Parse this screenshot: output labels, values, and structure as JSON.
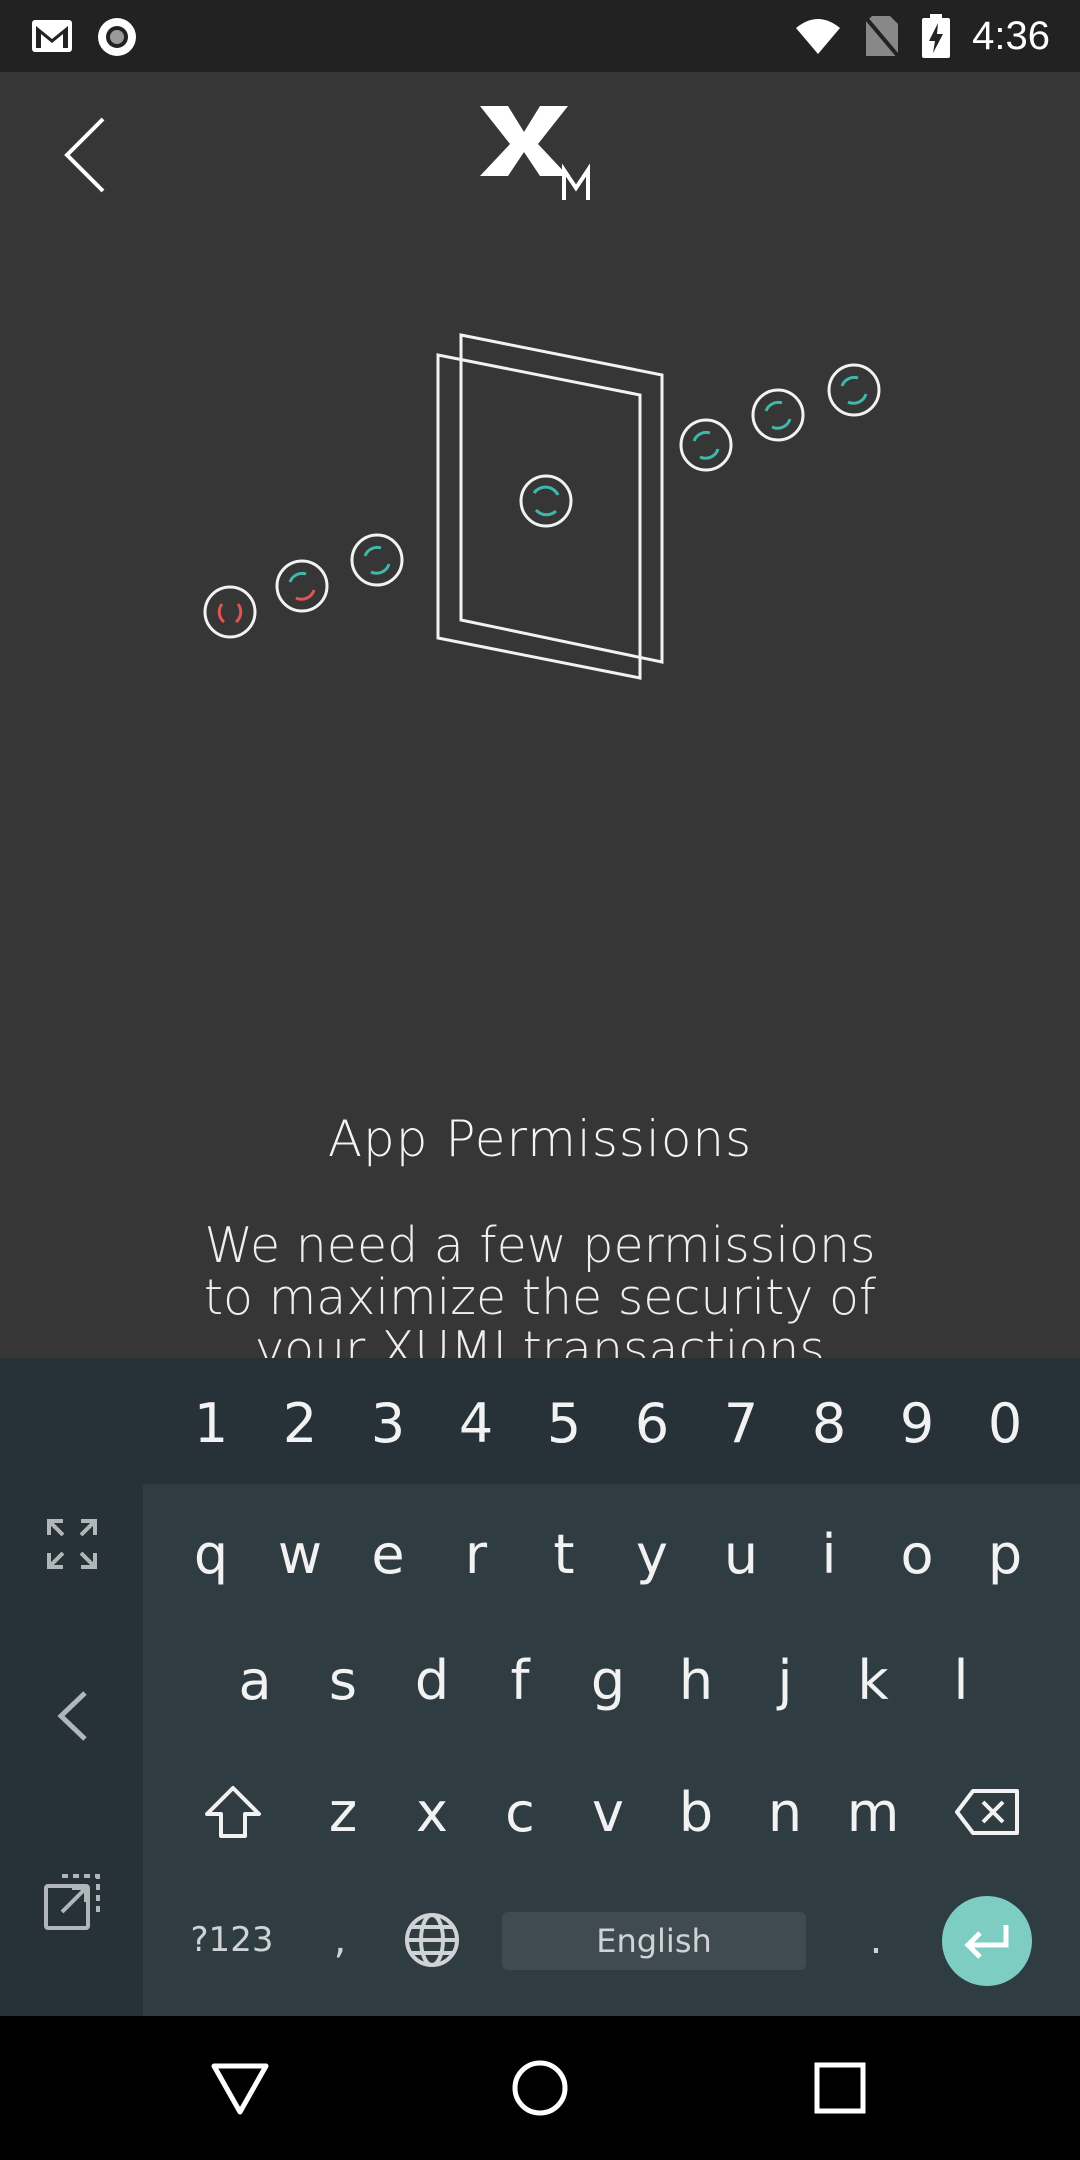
{
  "status_bar": {
    "time": "4:36",
    "icons": [
      "gmail-icon",
      "record-icon",
      "wifi-icon",
      "no-sim-icon",
      "battery-charging-icon"
    ]
  },
  "header": {
    "logo_mark": "X",
    "logo_sub": "M"
  },
  "content": {
    "title": "App Permissions",
    "description_lines": [
      "We need a few permissions",
      "to maximize the security of",
      "your XUMI transactions"
    ]
  },
  "keyboard": {
    "number_row": [
      "1",
      "2",
      "3",
      "4",
      "5",
      "6",
      "7",
      "8",
      "9",
      "0"
    ],
    "row1": [
      "q",
      "w",
      "e",
      "r",
      "t",
      "y",
      "u",
      "i",
      "o",
      "p"
    ],
    "row2": [
      "a",
      "s",
      "d",
      "f",
      "g",
      "h",
      "j",
      "k",
      "l"
    ],
    "row3": [
      "z",
      "x",
      "c",
      "v",
      "b",
      "n",
      "m"
    ],
    "symbols_label": "?123",
    "comma": ",",
    "space_label": "English",
    "period": "."
  },
  "colors": {
    "accent_teal": "#3fb8a9",
    "accent_red": "#e2544f",
    "enter_key": "#7ecdc3"
  }
}
